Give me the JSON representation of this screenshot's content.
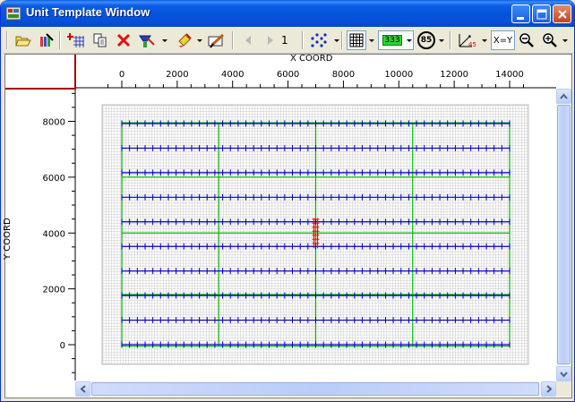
{
  "window": {
    "title": "Unit Template Window"
  },
  "toolbar": {
    "page_number": "1",
    "xy_label": "X=Y",
    "grid_label": "333",
    "zoom_percent": "85"
  },
  "icons": {
    "open": "folder-open-icon",
    "paint": "paint-brush-icon",
    "add_grid": "add-grid-icon",
    "copy": "copy-icon",
    "delete": "delete-x-icon",
    "marker": "marker-icon",
    "fill": "fill-icon",
    "edit": "edit-pencil-icon",
    "prev": "prev-page-icon",
    "next": "next-page-icon",
    "points": "points-icon",
    "grid": "grid-icon",
    "angle": "angle-45-icon",
    "zoom_out": "zoom-out-icon",
    "zoom_in": "zoom-in-icon"
  },
  "chart_data": {
    "type": "scatter",
    "xlabel": "X COORD",
    "ylabel": "Y COORD",
    "xlim": [
      -600,
      14600
    ],
    "ylim": [
      -1250,
      9000
    ],
    "x_ticks": [
      0,
      2000,
      4000,
      6000,
      8000,
      10000,
      12000,
      14000
    ],
    "y_ticks": [
      0,
      2000,
      4000,
      6000,
      8000
    ],
    "colors": {
      "grid": "#c8c8c8",
      "wells": "#0000c0",
      "blocks": "#00c000",
      "highlight": "#ff0000"
    },
    "well_rows_y": [
      0,
      880,
      1760,
      2640,
      3520,
      4400,
      5280,
      6160,
      7040,
      7920
    ],
    "well_row_x_range": [
      0,
      14000
    ],
    "well_spacing": 280,
    "block_lines_x": [
      0,
      3500,
      7000,
      10500,
      14000
    ],
    "block_lines_y": [
      -50,
      1800,
      4000,
      6000,
      7950
    ],
    "highlight": {
      "x": 7000,
      "y_from": 3520,
      "y_to": 4400
    }
  }
}
